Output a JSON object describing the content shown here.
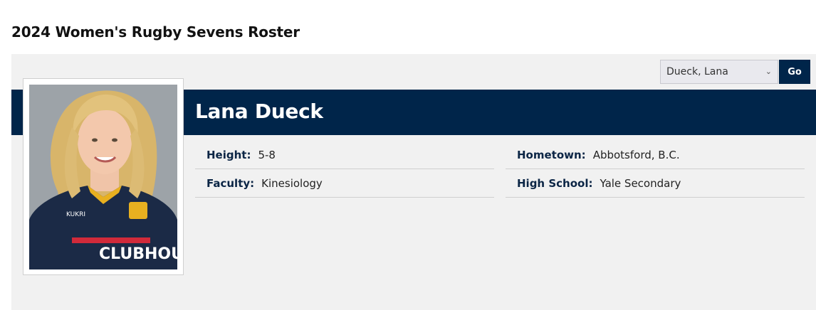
{
  "page": {
    "title": "2024 Women's Rugby Sevens Roster"
  },
  "selector": {
    "selected": "Dueck, Lana",
    "go_label": "Go"
  },
  "player": {
    "name": "Lana Dueck",
    "fields": {
      "height": {
        "label": "Height:",
        "value": "5-8"
      },
      "hometown": {
        "label": "Hometown:",
        "value": "Abbotsford, B.C."
      },
      "faculty": {
        "label": "Faculty:",
        "value": "Kinesiology"
      },
      "high_school": {
        "label": "High School:",
        "value": "Yale Secondary"
      }
    }
  },
  "colors": {
    "brand_navy": "#00254a",
    "panel_bg": "#f1f1f1",
    "jersey_gold": "#e8b020"
  }
}
